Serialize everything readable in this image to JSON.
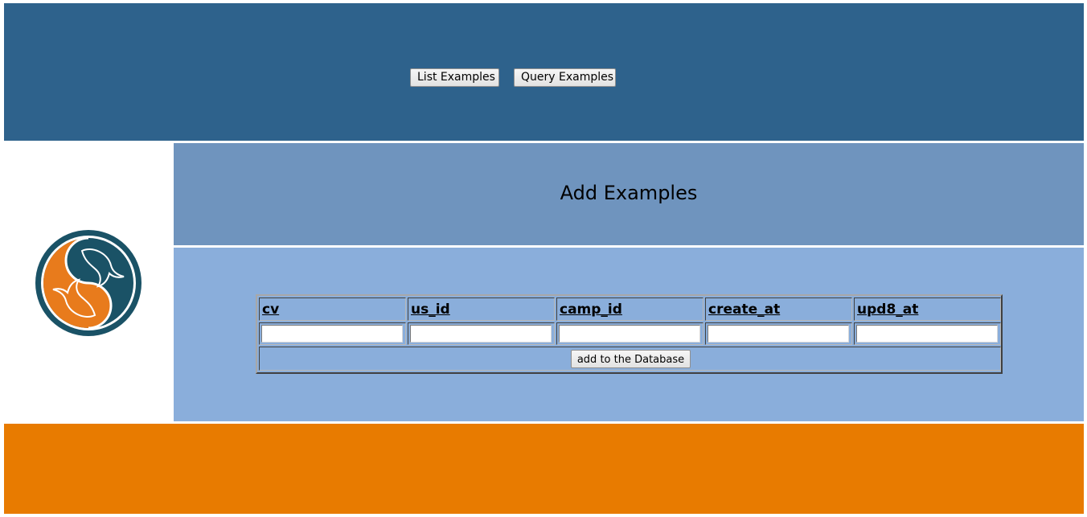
{
  "nav": {
    "list_label": "List Examples",
    "query_label": "Query Examples"
  },
  "logo": {
    "icon": "mysql-dolphin-yin-yang-icon",
    "colors": {
      "ring": "#1a5266",
      "orange": "#e87b1c",
      "teal": "#1a5266"
    }
  },
  "main": {
    "title": "Add Examples"
  },
  "form": {
    "columns": [
      "cv",
      "us_id",
      "camp_id",
      "create_at",
      "upd8_at"
    ],
    "values": [
      "",
      "",
      "",
      "",
      ""
    ],
    "submit_label": "add to the Database"
  },
  "colors": {
    "header_bg": "#2e628c",
    "title_bg": "#6f94be",
    "content_bg": "#8aaedb",
    "footer_bg": "#e87b00"
  }
}
